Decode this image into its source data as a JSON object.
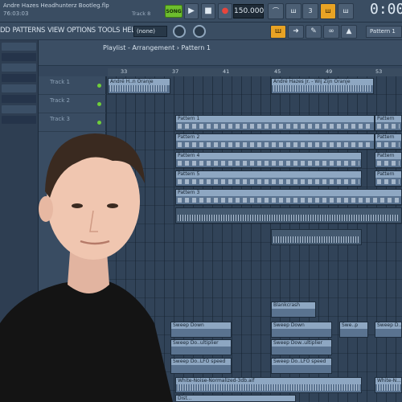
{
  "titlebar": {
    "project": "Andre Hazes Headhunterz Bootleg.flp",
    "time": "76:03:03",
    "track_hint": "Track 8"
  },
  "transport": {
    "song_label": "SONG",
    "play": "▶",
    "stop": "■",
    "record": "●",
    "tempo": "150.000",
    "time": "0:00"
  },
  "menu": {
    "items": [
      "DD",
      "PATTERNS",
      "VIEW",
      "OPTIONS",
      "TOOLS",
      "HELP"
    ],
    "pattern_select": "(none)",
    "snap_select": "Pattern 1"
  },
  "playlist": {
    "title": "Playlist - Arrangement › Pattern 1",
    "ruler": [
      "33",
      "37",
      "41",
      "45",
      "49",
      "53"
    ]
  },
  "tracks": [
    "Track 1",
    "Track 2",
    "Track 3"
  ],
  "clips": {
    "andre_1": "André H..n Oranje",
    "andre_2": "André Hazes Jr. - Wij Zijn Oranje",
    "p1": "Pattern 1",
    "p2": "Pattern 2",
    "p4": "Pattern 4",
    "p5": "Pattern 5",
    "p3": "Pattern 3",
    "blankcrash": "Blankcrash",
    "sweep_down_1": "Sweep Down",
    "sweep_down_2": "Sweep Down",
    "sweep_down_3": "Swe..p",
    "sweep_down_4": "Sweep D...",
    "sweep_mult_1": "Sweep Do..ultiplier",
    "sweep_mult_2": "Sweep Dow..ultiplier",
    "sweep_lfo_1": "Sweep Do..LFO speed",
    "sweep_lfo_2": "Sweep Do..LFO speed",
    "white_noise": "White-Noise-Normalized-3db.aif",
    "white_noise_2": "White-N...",
    "bottom": "Dist...",
    "right_p1": "Pattern",
    "right_p2": "Pattern",
    "right_p4": "Pattern",
    "right_p5": "Pattern"
  }
}
